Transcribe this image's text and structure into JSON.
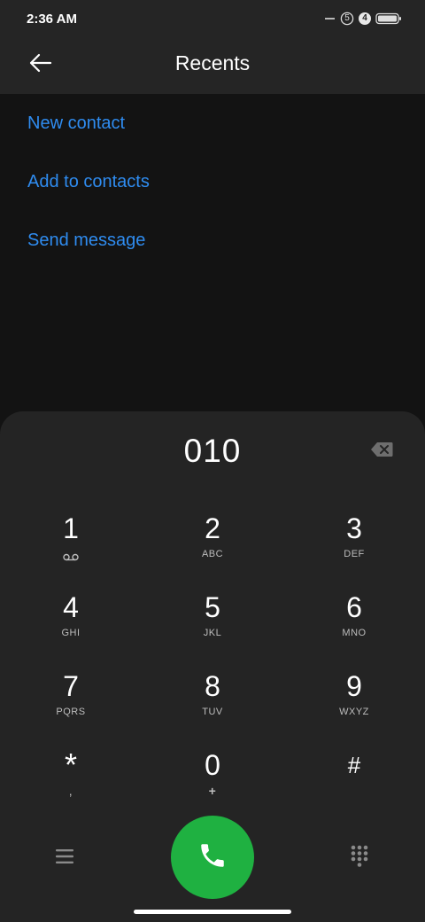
{
  "status_bar": {
    "time": "2:36 AM",
    "badge_a": "5",
    "badge_b": "4",
    "icons": [
      "key-icon",
      "notification-badge-icon",
      "notification-badge-icon",
      "battery-icon"
    ]
  },
  "app_bar": {
    "title": "Recents",
    "back_icon": "arrow-left-icon"
  },
  "menu": {
    "items": [
      {
        "label": "New contact"
      },
      {
        "label": "Add to contacts"
      },
      {
        "label": "Send message"
      }
    ]
  },
  "dialer": {
    "number": "010",
    "backspace_icon": "backspace-icon",
    "keys": [
      {
        "digit": "1",
        "letters": ""
      },
      {
        "digit": "2",
        "letters": "ABC"
      },
      {
        "digit": "3",
        "letters": "DEF"
      },
      {
        "digit": "4",
        "letters": "GHI"
      },
      {
        "digit": "5",
        "letters": "JKL"
      },
      {
        "digit": "6",
        "letters": "MNO"
      },
      {
        "digit": "7",
        "letters": "PQRS"
      },
      {
        "digit": "8",
        "letters": "TUV"
      },
      {
        "digit": "9",
        "letters": "WXYZ"
      },
      {
        "digit": "*",
        "letters": ","
      },
      {
        "digit": "0",
        "letters": "+"
      },
      {
        "digit": "#",
        "letters": ""
      }
    ],
    "bottom_icons": [
      "menu-icon",
      "phone-icon",
      "keypad-icon"
    ]
  },
  "colors": {
    "accent": "#2f8cf0",
    "call_green": "#1fb141",
    "panel": "#242424",
    "background": "#131313"
  }
}
